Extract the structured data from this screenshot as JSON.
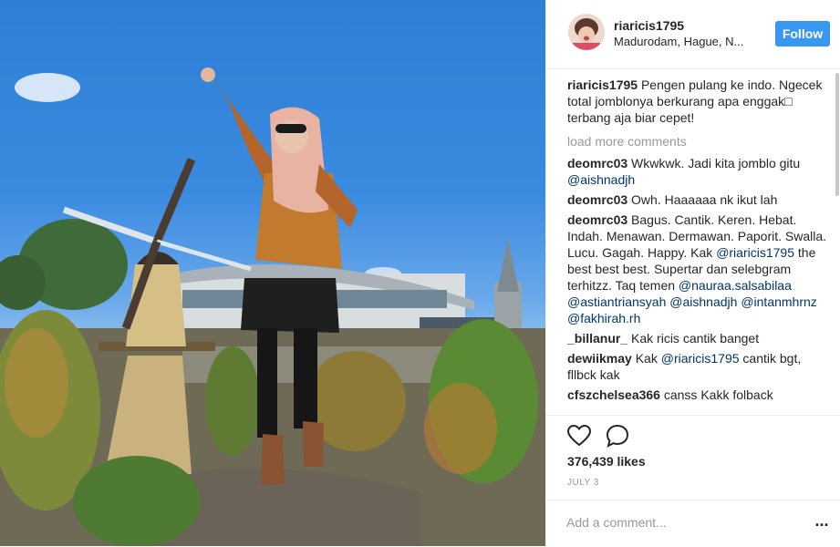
{
  "post": {
    "username": "riaricis1795",
    "location": "Madurodam, Hague, N...",
    "follow_label": "Follow",
    "caption": {
      "user": "riaricis1795",
      "text": "Pengen pulang ke indo. Ngecek total jomblonya berkurang apa enggak□ terbang aja biar cepet!"
    },
    "load_more": "load more comments",
    "comments": [
      {
        "user": "deomrc03",
        "parts": [
          "Wkwkwk. Jadi kita jomblo gitu ",
          "@aishnadjh"
        ]
      },
      {
        "user": "deomrc03",
        "parts": [
          "Owh. Haaaaaa nk ikut lah"
        ]
      },
      {
        "user": "deomrc03",
        "text": "Bagus. Cantik. Keren. Hebat. Indah. Menawan. Dermawan. Paporit. Swalla. Lucu. Gagah. Happy. Kak",
        "mention1": "@riaricis1795",
        "text2": " the best best best. Supertar dan selebgram terhitzz. Taq temen",
        "mention2": "@nauraa.salsabilaa",
        "mention3": "@astiantriansyah",
        "mention4": "@aishnadjh",
        "mention5": "@intanmhrnz",
        "mention6": "@fakhirah.rh"
      },
      {
        "user": "_billanur_",
        "parts": [
          "Kak ricis cantik banget"
        ]
      },
      {
        "user": "dewiikmay",
        "text": "Kak ",
        "mention1": "@riaricis1795",
        "text2": " cantik bgt, fllbck kak"
      },
      {
        "user": "cfszchelsea366",
        "parts": [
          "canss Kakk folback"
        ]
      }
    ],
    "likes": "376,439 likes",
    "date": "JULY 3",
    "comment_placeholder": "Add a comment...",
    "more_label": "..."
  },
  "icons": {
    "like": "heart-outline-icon",
    "comment": "speech-bubble-icon",
    "more": "ellipsis-icon"
  },
  "colors": {
    "accent": "#3897f0",
    "mention": "#003569",
    "muted": "#999999"
  }
}
